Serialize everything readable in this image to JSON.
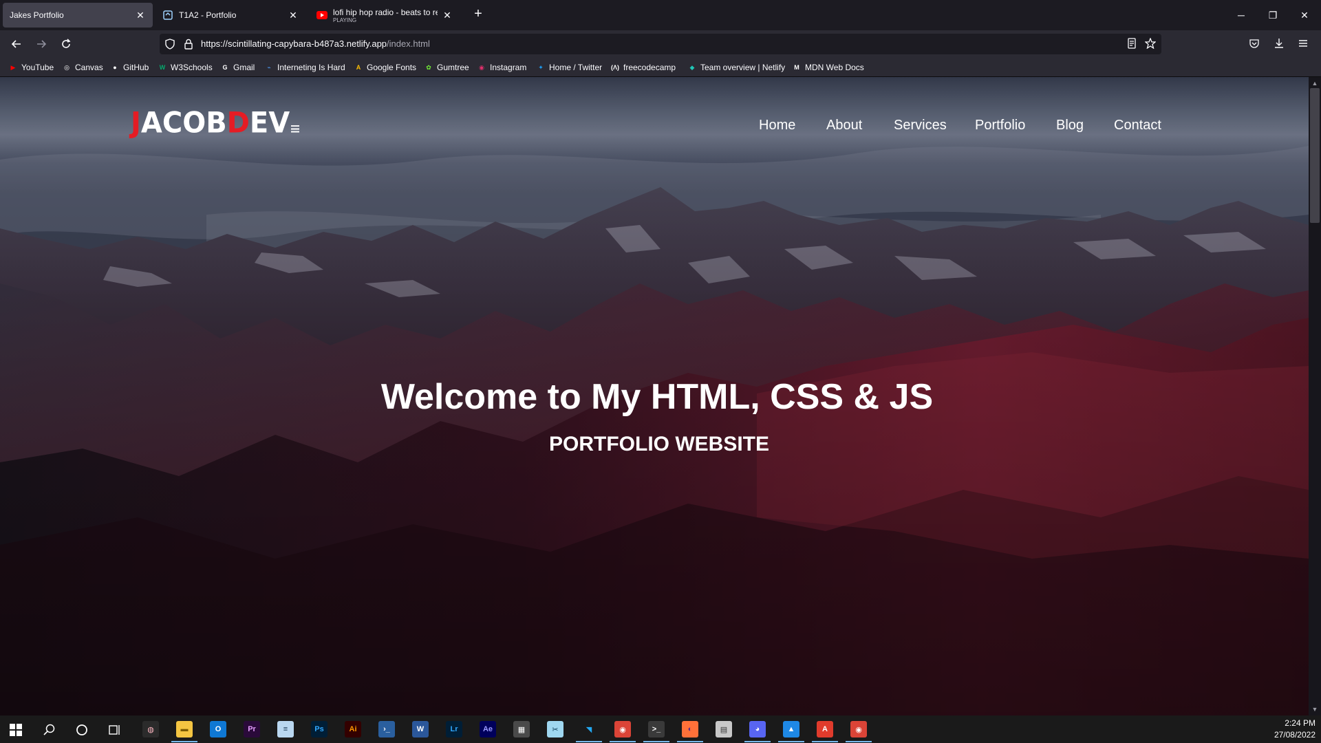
{
  "browser": {
    "tabs": [
      {
        "title": "Jakes Portfolio",
        "active": true
      },
      {
        "title": "T1A2 - Portfolio",
        "active": false
      },
      {
        "title": "lofi hip hop radio - beats to rela",
        "subtitle": "PLAYING",
        "active": false
      }
    ],
    "url": {
      "main": "https://scintillating-capybara-b487a3.netlify.app",
      "path": "/index.html"
    },
    "bookmarks": [
      {
        "label": "YouTube",
        "icon": "youtube-icon",
        "color": "#ff0000"
      },
      {
        "label": "Canvas",
        "icon": "canvas-icon",
        "color": "#ffffff"
      },
      {
        "label": "GitHub",
        "icon": "github-icon",
        "color": "#ffffff"
      },
      {
        "label": "W3Schools",
        "icon": "w3schools-icon",
        "color": "#04aa6d"
      },
      {
        "label": "Gmail",
        "icon": "google-icon",
        "color": "#ffffff"
      },
      {
        "label": "Interneting Is Hard",
        "icon": "interneting-icon",
        "color": "#4a90e2"
      },
      {
        "label": "Google Fonts",
        "icon": "google-fonts-icon",
        "color": "#fbbc04"
      },
      {
        "label": "Gumtree",
        "icon": "gumtree-icon",
        "color": "#72ef36"
      },
      {
        "label": "Instagram",
        "icon": "instagram-icon",
        "color": "#e1306c"
      },
      {
        "label": "Home / Twitter",
        "icon": "twitter-icon",
        "color": "#1d9bf0"
      },
      {
        "label": "freecodecamp",
        "icon": "freecodecamp-icon",
        "color": "#ffffff"
      },
      {
        "label": "Team overview | Netlify",
        "icon": "netlify-icon",
        "color": "#20c6b7"
      },
      {
        "label": "MDN Web Docs",
        "icon": "mdn-icon",
        "color": "#ffffff"
      }
    ]
  },
  "site": {
    "logo": {
      "first": "J",
      "rest": "ACOB",
      "dev_d": "D",
      "dev_rest": "EV"
    },
    "nav": [
      "Home",
      "About",
      "Services",
      "Portfolio",
      "Blog",
      "Contact"
    ],
    "hero_title": "Welcome to My HTML, CSS & JS",
    "hero_subtitle": "PORTFOLIO WEBSITE"
  },
  "taskbar": {
    "time": "2:24 PM",
    "date": "27/08/2022",
    "apps": [
      {
        "icon": "paint-icon",
        "label": ""
      },
      {
        "icon": "file-explorer-icon",
        "label": ""
      },
      {
        "icon": "outlook-icon",
        "label": ""
      },
      {
        "icon": "premiere-icon",
        "label": "Pr"
      },
      {
        "icon": "notepad-icon",
        "label": ""
      },
      {
        "icon": "photoshop-icon",
        "label": "Ps"
      },
      {
        "icon": "illustrator-icon",
        "label": "Ai"
      },
      {
        "icon": "powershell-icon",
        "label": ""
      },
      {
        "icon": "word-icon",
        "label": ""
      },
      {
        "icon": "lightroom-icon",
        "label": "Lr"
      },
      {
        "icon": "after-effects-icon",
        "label": "Ae"
      },
      {
        "icon": "calculator-icon",
        "label": ""
      },
      {
        "icon": "snip-icon",
        "label": ""
      },
      {
        "icon": "vscode-icon",
        "label": ""
      },
      {
        "icon": "chrome-icon",
        "label": ""
      },
      {
        "icon": "terminal-icon",
        "label": ""
      },
      {
        "icon": "firefox-icon",
        "label": ""
      },
      {
        "icon": "app-icon",
        "label": ""
      },
      {
        "icon": "discord-icon",
        "label": ""
      },
      {
        "icon": "photos-icon",
        "label": ""
      },
      {
        "icon": "acrobat-icon",
        "label": ""
      },
      {
        "icon": "chrome-dev-icon",
        "label": ""
      }
    ]
  }
}
